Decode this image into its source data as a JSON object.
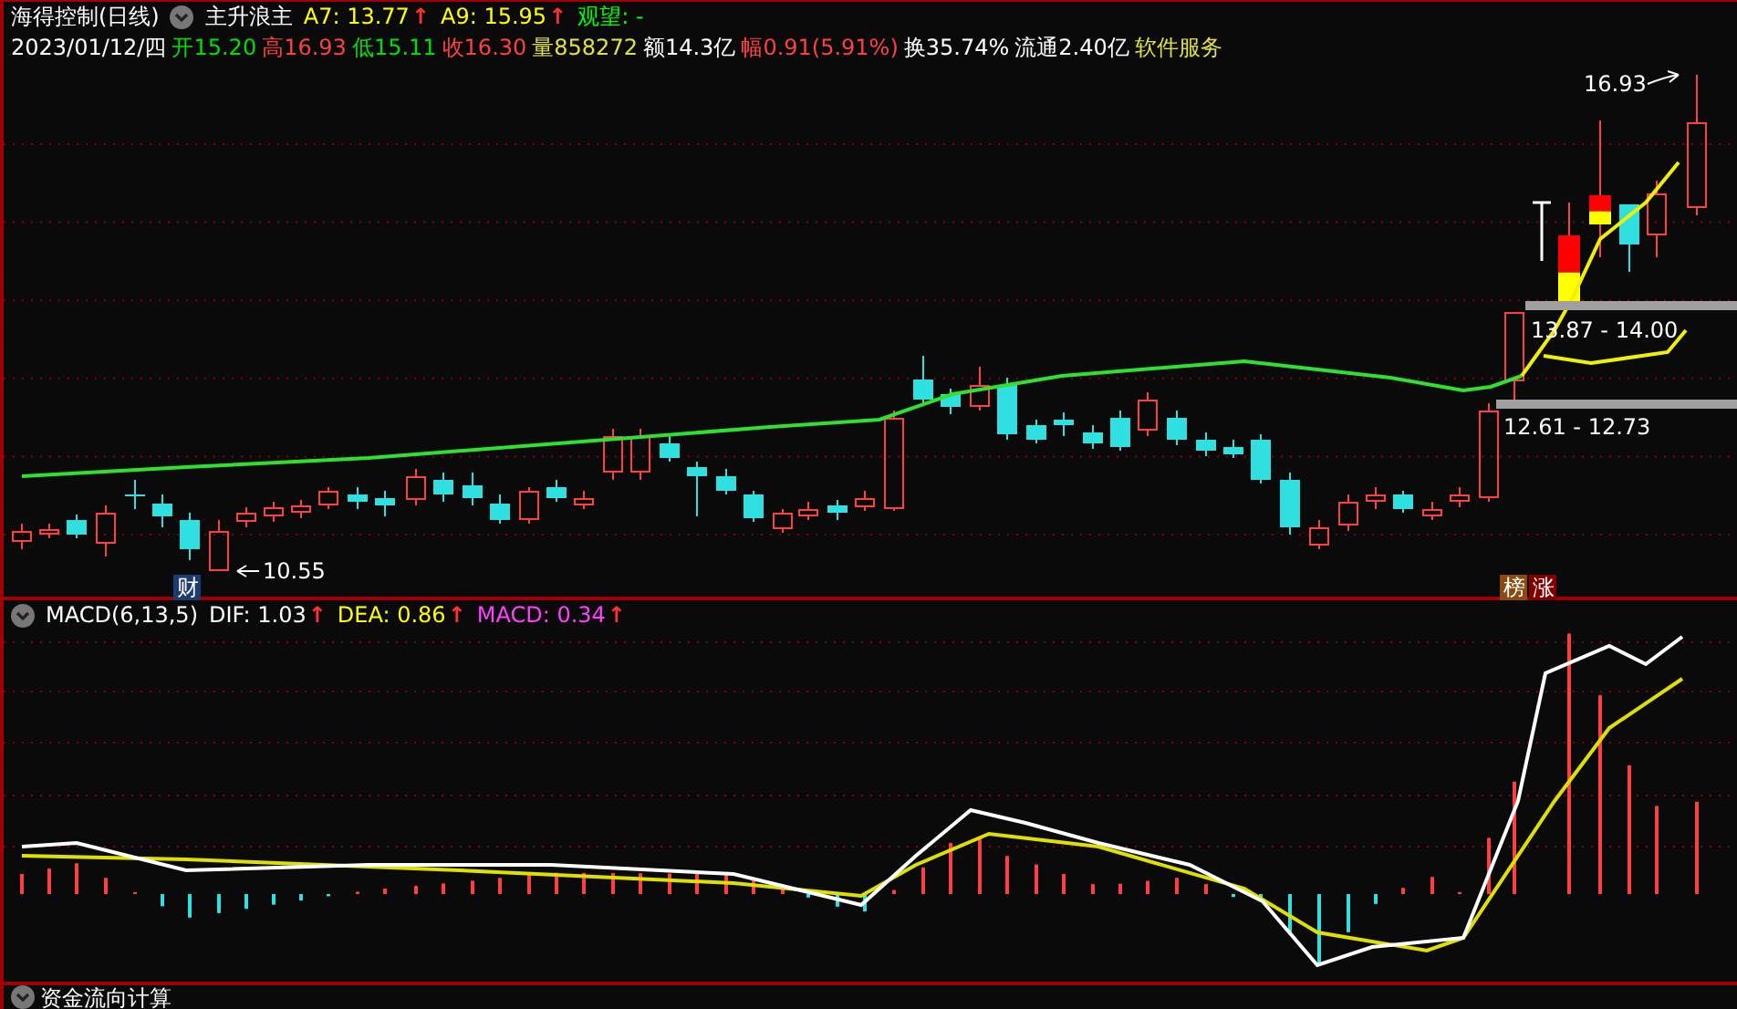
{
  "header": {
    "title": "海得控制(日线)",
    "indicator": "主升浪主",
    "values": [
      {
        "text": "A7: 13.77",
        "color": "#ffff00",
        "arrow": "↑"
      },
      {
        "text": "A9: 15.95",
        "color": "#ffff00",
        "arrow": "↑"
      },
      {
        "text": "观望: -",
        "color": "#00ff00"
      }
    ]
  },
  "quote": [
    {
      "text": "2023/01/12/四",
      "color": "#ffffff"
    },
    {
      "text": "开15.20",
      "color": "#00e000"
    },
    {
      "text": "高16.93",
      "color": "#ff4040"
    },
    {
      "text": "低15.11",
      "color": "#00e000"
    },
    {
      "text": "收16.30",
      "color": "#ff4040"
    },
    {
      "text": "量858272",
      "color": "#e0e040"
    },
    {
      "text": "额14.3亿",
      "color": "#ffffff"
    },
    {
      "text": "幅0.91(5.91%)",
      "color": "#ff4040"
    },
    {
      "text": "换35.74%",
      "color": "#ffffff"
    },
    {
      "text": "流通2.40亿",
      "color": "#ffffff"
    },
    {
      "text": "软件服务",
      "color": "#e0e040"
    }
  ],
  "price_chart": {
    "labels": [
      {
        "kind": "low_marker",
        "text": "10.55"
      },
      {
        "kind": "high_marker",
        "text": "16.93"
      },
      {
        "kind": "range",
        "text": "13.87 - 14.00"
      },
      {
        "kind": "range",
        "text": "12.61 - 12.73"
      }
    ],
    "tags": [
      {
        "text": "财",
        "color": "#1c3c70"
      },
      {
        "text": "榜",
        "color": "#8a4a10"
      },
      {
        "text": "涨",
        "color": "#800000"
      }
    ]
  },
  "macd": {
    "title": "MACD(6,13,5)",
    "values": [
      {
        "text": "DIF: 1.03",
        "color": "#ffffff",
        "arrow": "↑"
      },
      {
        "text": "DEA: 0.86",
        "color": "#ffff00",
        "arrow": "↑"
      },
      {
        "text": "MACD: 0.34",
        "color": "#ff40ff",
        "arrow": "↑"
      }
    ]
  },
  "bottom_panel": {
    "title": "资金流向计算"
  }
}
